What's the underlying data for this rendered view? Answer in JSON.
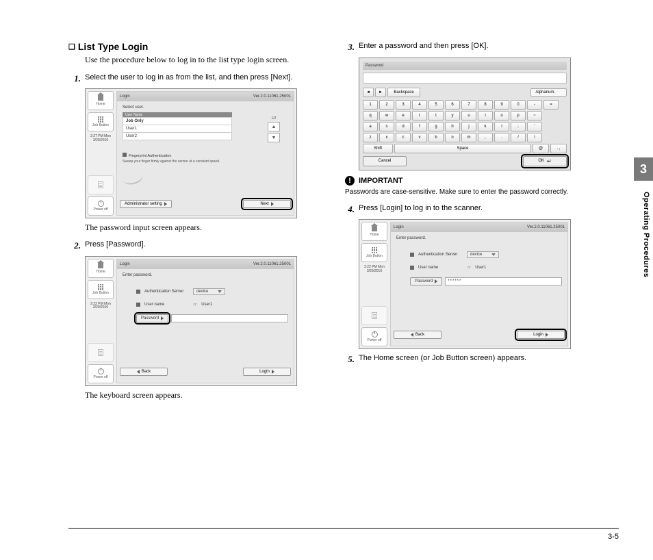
{
  "leftColumn": {
    "sectionTitle": "List Type Login",
    "intro": "Use the procedure below to log in to the list type login screen.",
    "step1": "Select the user to log in as from the list, and then press [Next].",
    "fig1": {
      "headerLeft": "Login",
      "headerRight": "Ver.2.0.11061.25001",
      "selectUser": "Select user.",
      "listHeader": "User Name",
      "row1": "Job Only",
      "row2": "User1",
      "row3": "User2",
      "counter": "1/2",
      "authTitle": "Fingerprint Authentication",
      "authText": "Sweep your finger firmly against the sensor at a constant speed.",
      "adminBtn": "Administrator setting",
      "nextBtn": "Next",
      "homeBtn": "Home",
      "jobBtn": "Job Button",
      "time": "2:27 PM  Mon 3/29/2010",
      "powerBtn": "Power off"
    },
    "caption1": "The password input screen appears.",
    "step2": "Press [Password].",
    "fig2": {
      "headerLeft": "Login",
      "headerRight": "Ver.2.0.11061.25001",
      "enterPwd": "Enter password.",
      "authServer": "Authentication Server",
      "device": "device",
      "userName": "User name",
      "userVal": "User1",
      "pwdLabel": "Password",
      "backBtn": "Back",
      "loginBtn": "Login",
      "homeBtn": "Home",
      "jobBtn": "Job Button",
      "time": "2:22 PM  Mon 3/29/2010",
      "powerBtn": "Power off"
    },
    "caption2": "The keyboard screen appears."
  },
  "rightColumn": {
    "step3": "Enter a password and then press [OK].",
    "keyboard": {
      "title": "Password",
      "backspace": "Backspace",
      "mode": "Alphanum.",
      "row1": [
        "1",
        "2",
        "3",
        "4",
        "5",
        "6",
        "7",
        "8",
        "9",
        "0",
        "-",
        "="
      ],
      "row2": [
        "q",
        "w",
        "e",
        "r",
        "t",
        "y",
        "u",
        "i",
        "o",
        "p",
        "~"
      ],
      "row3": [
        "a",
        "s",
        "d",
        "f",
        "g",
        "h",
        "j",
        "k",
        "l",
        ";",
        "'"
      ],
      "row4": [
        "z",
        "x",
        "c",
        "v",
        "b",
        "n",
        "m",
        ",",
        ".",
        "/",
        "\\"
      ],
      "shift": "Shift",
      "space": "Space",
      "at": "@",
      "ext": ". ,",
      "cancel": "Cancel",
      "ok": "OK"
    },
    "importantLabel": "IMPORTANT",
    "importantText": "Passwords are case-sensitive. Make sure to enter the password correctly.",
    "step4": "Press [Login] to log in to the scanner.",
    "fig4": {
      "headerLeft": "Login",
      "headerRight": "Ver.2.0.11061.25001",
      "enterPwd": "Enter password.",
      "authServer": "Authentication Server",
      "device": "device",
      "userName": "User name",
      "userVal": "User1",
      "pwdLabel": "Password",
      "pwdMasked": "******",
      "backBtn": "Back",
      "loginBtn": "Login",
      "homeBtn": "Home",
      "jobBtn": "Job Button",
      "time": "2:22 PM  Mon 3/29/2010",
      "powerBtn": "Power off"
    },
    "step5": "The Home screen (or Job Button screen) appears."
  },
  "chapterNumber": "3",
  "sideLabel": "Operating Procedures",
  "pageNumber": "3-5"
}
